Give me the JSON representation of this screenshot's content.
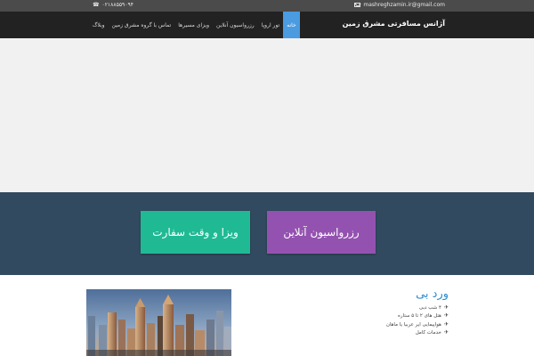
{
  "topbar": {
    "email": "mashreghzamin.ir@gmail.com",
    "phone": "۰۲۱۸۸۵۵۹۰۹۴",
    "icons": {
      "email": "mail-icon",
      "phone": "phone-icon"
    }
  },
  "nav": {
    "brand": "آژانس مسافرتی مشرق زمین",
    "items": [
      {
        "label": "خانه",
        "active": true
      },
      {
        "label": "تور اروپا",
        "active": false
      },
      {
        "label": "رزرواسیون آنلاین",
        "active": false
      },
      {
        "label": "ویزای مسیرها",
        "active": false
      },
      {
        "label": "تماس با گروه مشرق زمین",
        "active": false
      },
      {
        "label": "وبلاگ",
        "active": false
      }
    ]
  },
  "banner": {
    "visa_button": "ویزا و وقت سفارت",
    "reserve_button": "رزرواسیون آنلاین"
  },
  "tour": {
    "title": "ورد بی",
    "features": [
      "۴ شب دبی",
      "هتل های ۲ تا ۵ ستاره",
      "هواپیمایی ایر عربیا یا ماهان",
      "خدمات کامل"
    ]
  },
  "colors": {
    "topbar": "#4b4b4b",
    "nav": "#222222",
    "nav_active": "#4a9be0",
    "banner": "#324a60",
    "visa_button": "#1fba94",
    "reserve_button": "#9452b0",
    "tour_title": "#2e8bd0"
  }
}
